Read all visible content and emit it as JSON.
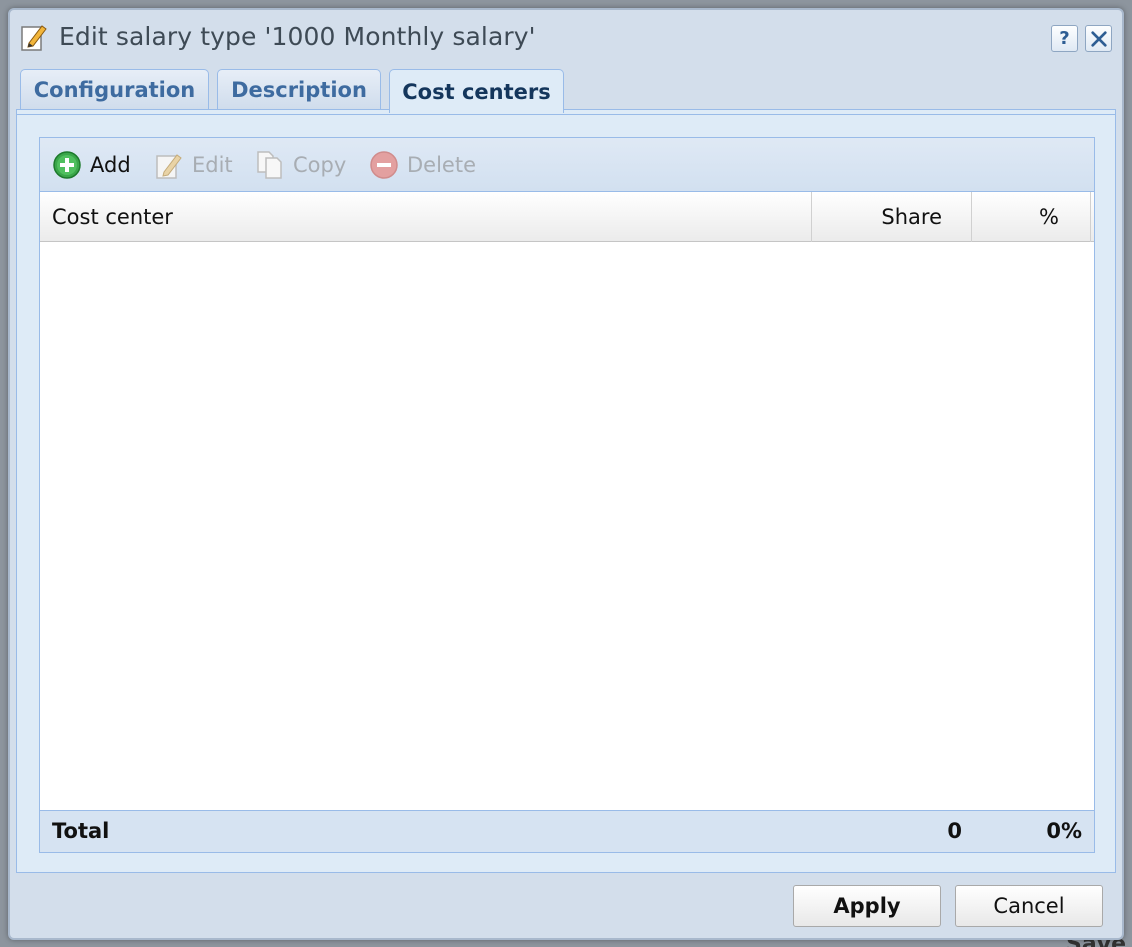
{
  "dialog": {
    "title": "Edit salary type '1000 Monthly salary'",
    "help_label": "?",
    "close_label": "✕"
  },
  "tabs": [
    {
      "label": "Configuration",
      "active": false
    },
    {
      "label": "Description",
      "active": false
    },
    {
      "label": "Cost centers",
      "active": true
    }
  ],
  "toolbar": {
    "add_label": "Add",
    "edit_label": "Edit",
    "copy_label": "Copy",
    "delete_label": "Delete"
  },
  "grid": {
    "columns": [
      "Cost center",
      "Share",
      "%"
    ],
    "rows": []
  },
  "totals": {
    "label": "Total",
    "share": "0",
    "percent": "0%"
  },
  "buttons": {
    "apply_label": "Apply",
    "cancel_label": "Cancel"
  },
  "background": {
    "partial_label": "Save"
  }
}
